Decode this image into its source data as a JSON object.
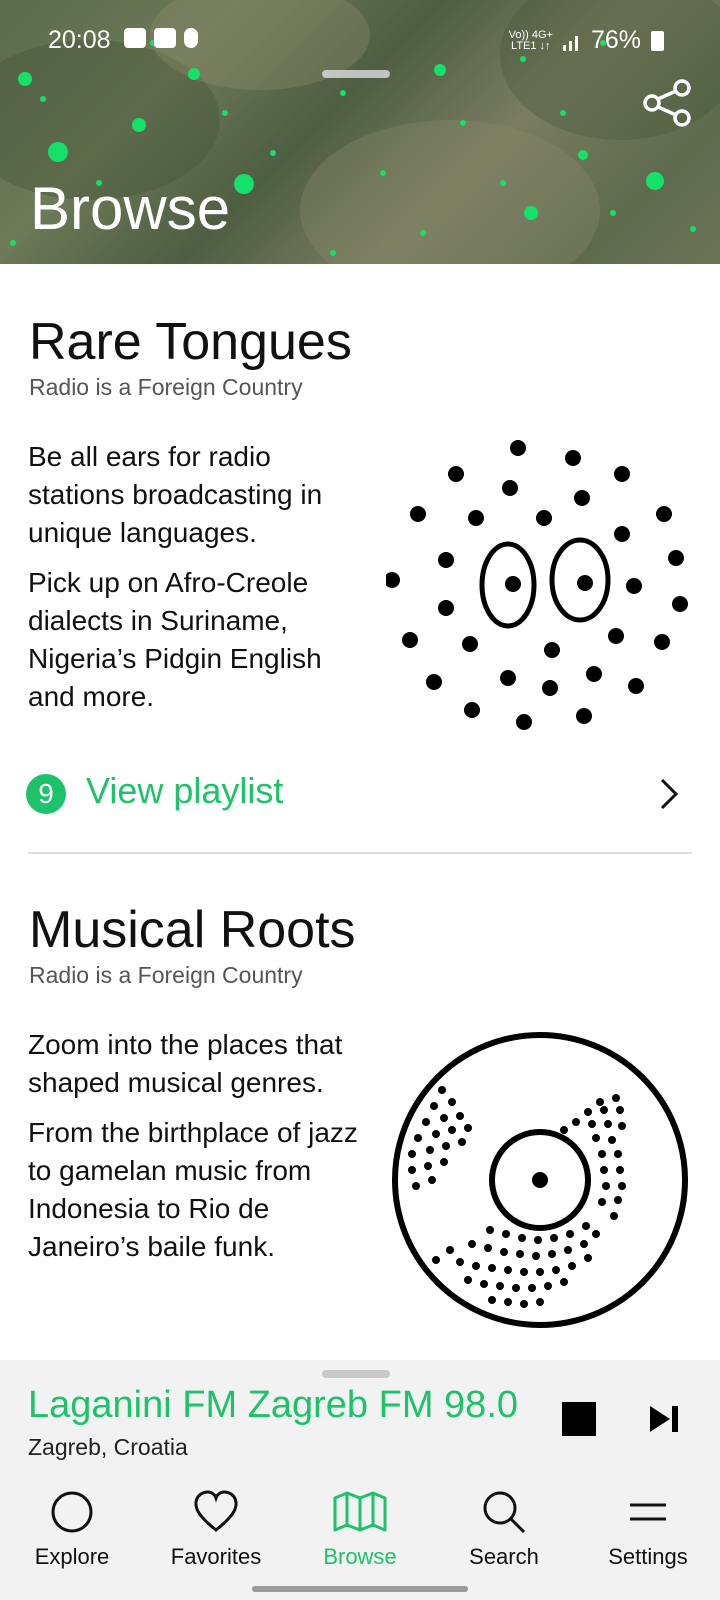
{
  "status_bar": {
    "time": "20:08",
    "network_top": "Vo)) 4G+",
    "network_bottom": "LTE1 ↓↑",
    "battery": "76%"
  },
  "header": {
    "title": "Browse",
    "share_icon": "share-icon"
  },
  "sections": [
    {
      "title": "Rare Tongues",
      "subtitle": "Radio is a Foreign Country",
      "paragraphs": [
        "Be all ears for radio stations broadcasting in unique languages.",
        "Pick up on Afro-Creole dialects in Suriname, Nigeria’s Pidgin English and more."
      ],
      "playlist_count": "9",
      "playlist_label": "View playlist",
      "illustration": "eyes-dots-illustration"
    },
    {
      "title": "Musical Roots",
      "subtitle": "Radio is a Foreign Country",
      "paragraphs": [
        "Zoom into the places that shaped musical genres.",
        "From the birthplace of jazz to gamelan music from Indonesia to Rio de Janeiro’s baile funk."
      ],
      "illustration": "vinyl-record-illustration"
    }
  ],
  "player": {
    "station": "Laganini FM Zagreb FM 98.0",
    "location": "Zagreb, Croatia",
    "stop_icon": "stop-icon",
    "next_icon": "skip-next-icon"
  },
  "nav": {
    "items": [
      {
        "label": "Explore",
        "icon": "circle-icon"
      },
      {
        "label": "Favorites",
        "icon": "heart-icon"
      },
      {
        "label": "Browse",
        "icon": "map-icon"
      },
      {
        "label": "Search",
        "icon": "search-icon"
      },
      {
        "label": "Settings",
        "icon": "menu-icon"
      }
    ],
    "active": "Browse"
  },
  "colors": {
    "accent": "#1ec26a",
    "background": "#ffffff",
    "player_bg": "#f2f2f2"
  }
}
